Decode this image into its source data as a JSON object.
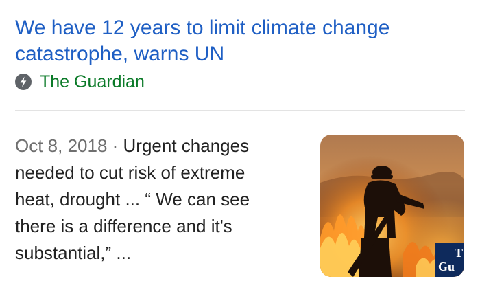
{
  "result": {
    "headline": "We have 12 years to limit climate change catastrophe, warns UN",
    "source": "The Guardian",
    "date": "Oct 8, 2018",
    "separator": " · ",
    "snippet": "Urgent changes needed to cut risk of extreme heat, drought ... “ We can see there is a difference and it's substantial,” ...",
    "thumbnail": {
      "icon": "firefighter-wildfire-photo",
      "logo_line1": "T",
      "logo_line2": "Gu"
    }
  },
  "colors": {
    "headline": "#1f5fc4",
    "source": "#0b7a28",
    "date": "#6f6f6f",
    "snippet": "#222222",
    "divider": "#e3e3e3",
    "amp_badge": "#5f6368"
  }
}
